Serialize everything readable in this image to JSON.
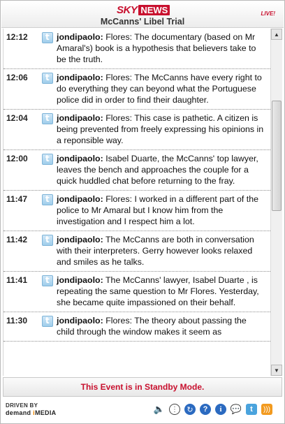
{
  "header": {
    "logo_sky": "SKY",
    "logo_news": "NEWS",
    "title": "McCanns' Libel Trial",
    "live": "LIVE!"
  },
  "entries": [
    {
      "time": "12:12",
      "author": "jondipaolo:",
      "text": "Flores: The documentary (based on Mr Amaral's) book is a hypothesis that believers take to be the truth."
    },
    {
      "time": "12:06",
      "author": "jondipaolo:",
      "text": "Flores: The McCanns have every right to do everything they can beyond what the Portuguese police did in order to find their daughter."
    },
    {
      "time": "12:04",
      "author": "jondipaolo:",
      "text": "Flores: This case is pathetic. A citizen is being prevented from freely expressing his opinions in a reponsible way."
    },
    {
      "time": "12:00",
      "author": "jondipaolo:",
      "text": "Isabel Duarte, the McCanns' top lawyer, leaves the bench and approaches the couple for a quick huddled chat before returning to the fray."
    },
    {
      "time": "11:47",
      "author": "jondipaolo:",
      "text": "Flores: I worked in a different part of the police to Mr Amaral but I know him from the investigation and I respect him a lot."
    },
    {
      "time": "11:42",
      "author": "jondipaolo:",
      "text": "The McCanns are both in conversation with their interpreters. Gerry however looks relaxed and smiles as he talks."
    },
    {
      "time": "11:41",
      "author": "jondipaolo:",
      "text": "The McCanns' lawyer, Isabel Duarte , is repeating the same question to Mr Flores. Yesterday, she became quite impassioned on their behalf."
    },
    {
      "time": "11:30",
      "author": "jondipaolo:",
      "text": "Flores: The theory about passing the child through the window makes it seem as"
    }
  ],
  "status": {
    "standby": "This Event is in Standby Mode."
  },
  "footer": {
    "driven_by": "DRIVEN BY",
    "brand_demand": "demand",
    "brand_i": "i",
    "brand_media": "MEDIA"
  },
  "icons": {
    "entry_icon": "twitter-icon",
    "tools": [
      "speaker-icon",
      "options-icon",
      "refresh-icon",
      "help-icon",
      "info-icon",
      "chat-icon",
      "twitter-icon",
      "rss-icon"
    ]
  },
  "colors": {
    "brand_red": "#c8102e",
    "brand_orange": "#f08a00"
  }
}
